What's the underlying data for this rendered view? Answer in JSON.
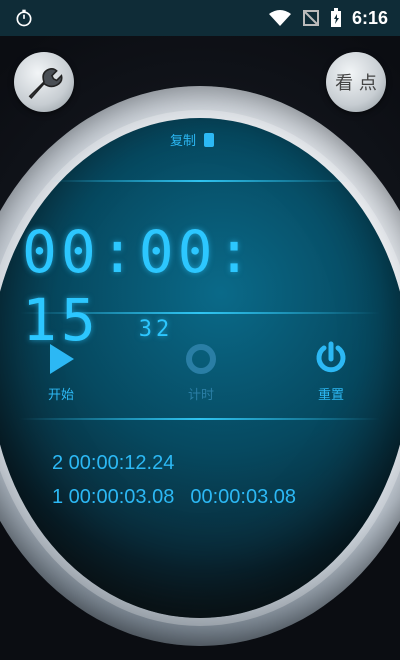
{
  "status_bar": {
    "time": "6:16"
  },
  "top": {
    "tool_button_label": "tool",
    "view_button_label": "看 点"
  },
  "copy": {
    "label": "复制"
  },
  "clock": {
    "display": "00:00: 15",
    "suffix": "32"
  },
  "controls": {
    "start_label": "开始",
    "lap_label": "计时",
    "reset_label": "重置"
  },
  "laps": [
    {
      "text": "2 00:00:12.24",
      "split": ""
    },
    {
      "text": "1 00:00:03.08",
      "split": "00:00:03.08"
    }
  ],
  "colors": {
    "accent": "#2cb8f4",
    "statusbar": "#0f2c37"
  }
}
